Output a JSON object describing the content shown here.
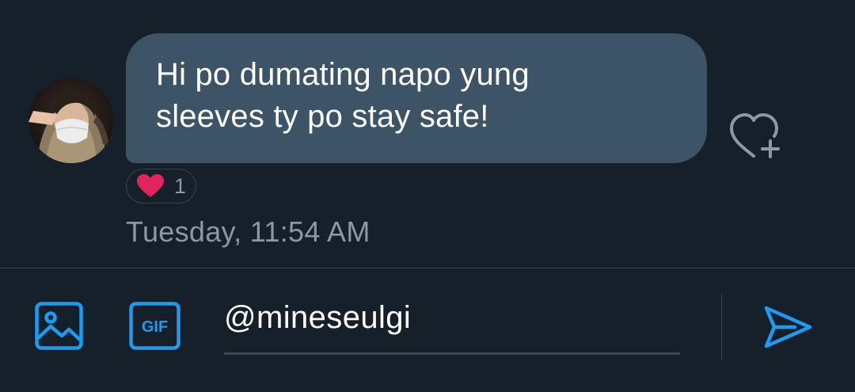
{
  "conversation": {
    "message": {
      "text": "Hi po dumating napo yung sleeves ty po stay safe!",
      "timestamp": "Tuesday, 11:54 AM",
      "reaction": {
        "emoji": "heart-icon",
        "count": "1",
        "color": "#f91880"
      }
    }
  },
  "composer": {
    "input_value": "@mineseulgi",
    "media_icon": "image-icon",
    "gif_icon": "gif-icon",
    "gif_label": "GIF",
    "send_icon": "send-icon",
    "accent_color": "#1d9bf0"
  },
  "theme": {
    "background": "#15202b",
    "bubble": "#3d5466",
    "muted_text": "#8b98a5"
  }
}
